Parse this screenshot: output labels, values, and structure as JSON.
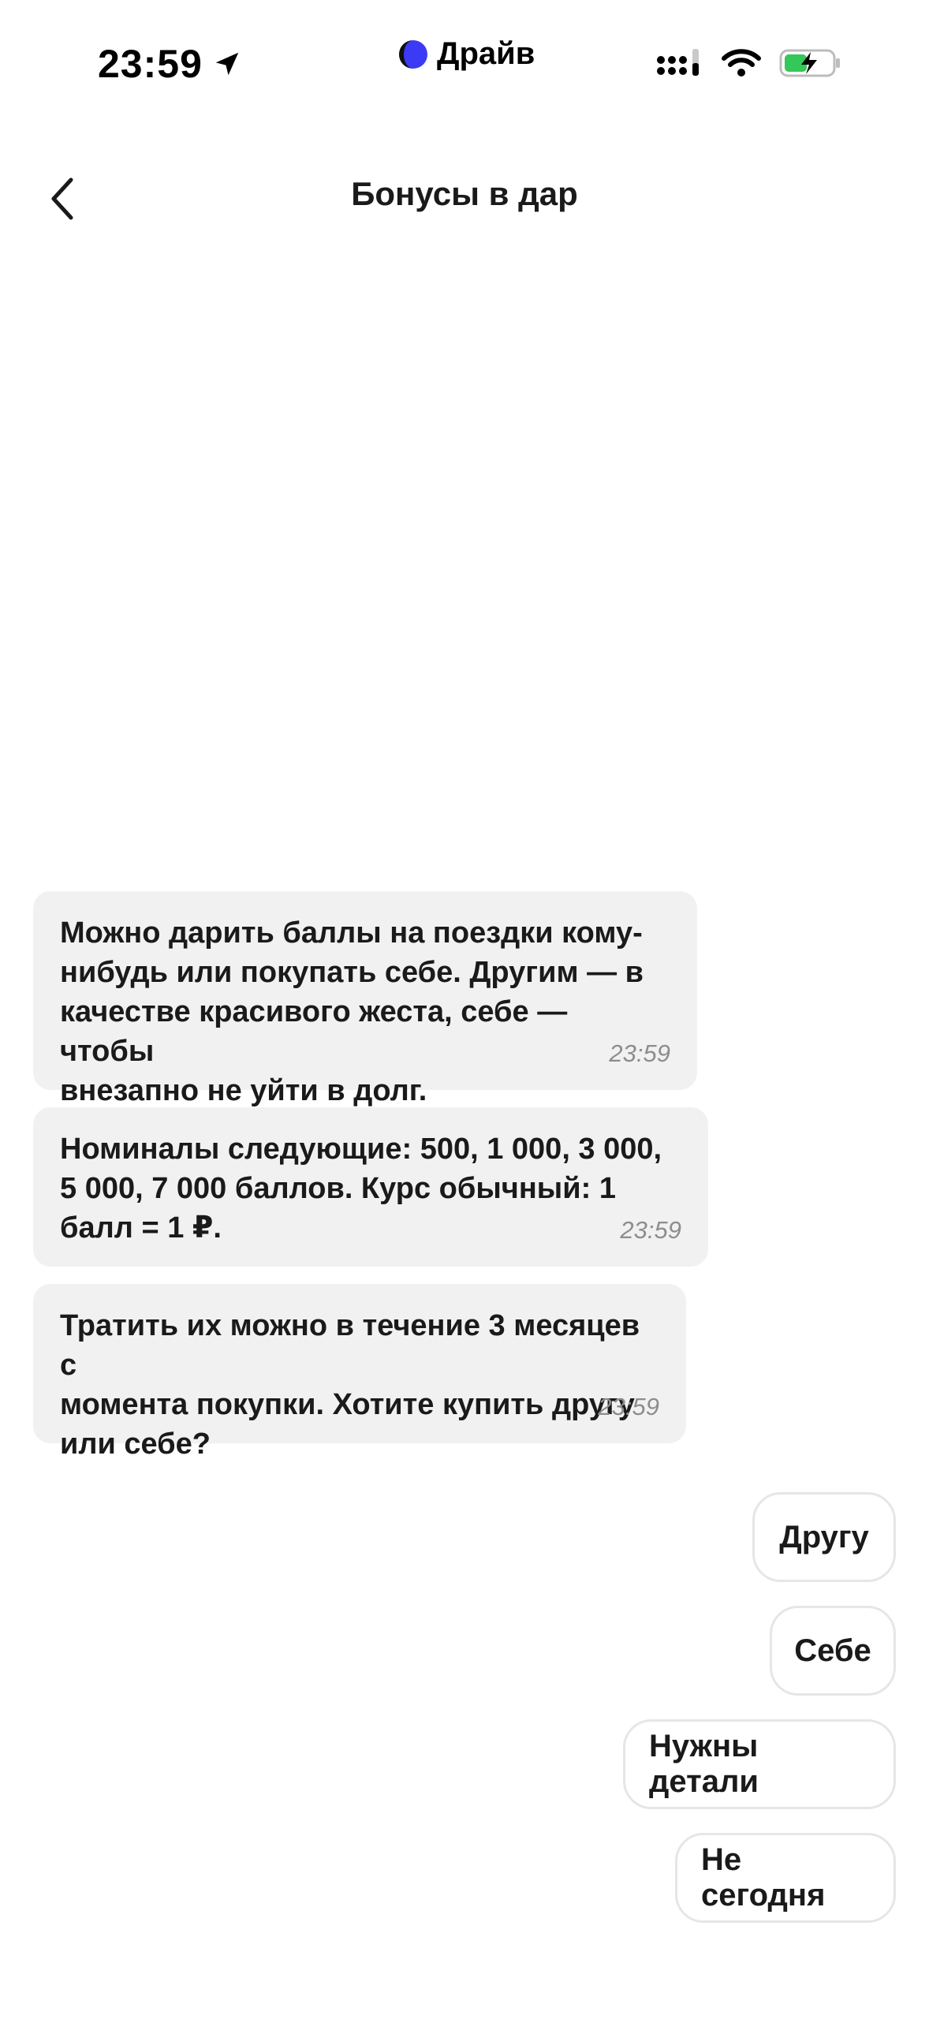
{
  "status_bar": {
    "time": "23:59",
    "app_name": "Драйв"
  },
  "header": {
    "title": "Бонусы в дар"
  },
  "messages": [
    {
      "text": "Можно дарить баллы на поездки кому-\nнибудь или покупать себе. Другим — в\nкачестве красивого жеста, себе — чтобы\nвнезапно не уйти в долг.",
      "time": "23:59"
    },
    {
      "text": "Номиналы следующие: 500, 1 000, 3 000,\n5 000, 7 000 баллов. Курс обычный: 1\nбалл = 1 ₽.",
      "time": "23:59"
    },
    {
      "text": "Тратить их можно в течение 3 месяцев с\nмомента покупки. Хотите купить другу\nили себе?",
      "time": "23:59"
    }
  ],
  "quick_replies": [
    {
      "label": "Другу"
    },
    {
      "label": "Себе"
    },
    {
      "label": "Нужны детали"
    },
    {
      "label": "Не сегодня"
    }
  ],
  "colors": {
    "bubble_bg": "#f1f1f1",
    "time_text": "#8d8d8d",
    "battery_fill": "#34c759"
  }
}
